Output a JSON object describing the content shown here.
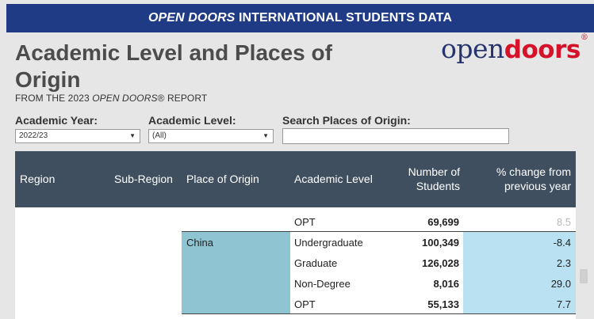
{
  "banner": {
    "italic": "OPEN DOORS",
    "rest": " INTERNATIONAL STUDENTS DATA"
  },
  "title": "Academic Level and Places of Origin",
  "subtitle": {
    "prefix": "FROM THE 2023 ",
    "italic": "OPEN DOORS",
    "suffix": "® REPORT"
  },
  "logo": {
    "open": "open",
    "doors": "doors",
    "reg": "®"
  },
  "filters": {
    "academic_year": {
      "label": "Academic Year:",
      "value": "2022/23"
    },
    "academic_level": {
      "label": "Academic Level:",
      "value": "(All)"
    },
    "search": {
      "label": "Search Places of Origin:",
      "value": ""
    }
  },
  "table": {
    "headers": {
      "region": "Region",
      "sub_region": "Sub-Region",
      "place": "Place of Origin",
      "level": "Academic Level",
      "number_1": "Number of",
      "number_2": "Students",
      "pct_1": "% change from",
      "pct_2": "previous year"
    },
    "top_row": {
      "level": "OPT",
      "number": "69,699",
      "pct": "8.5"
    },
    "place": "China",
    "rows": [
      {
        "level": "Undergraduate",
        "number": "100,349",
        "pct": "-8.4"
      },
      {
        "level": "Graduate",
        "number": "126,028",
        "pct": "2.3"
      },
      {
        "level": "Non-Degree",
        "number": "8,016",
        "pct": "29.0"
      },
      {
        "level": "OPT",
        "number": "55,133",
        "pct": "7.7"
      }
    ]
  }
}
